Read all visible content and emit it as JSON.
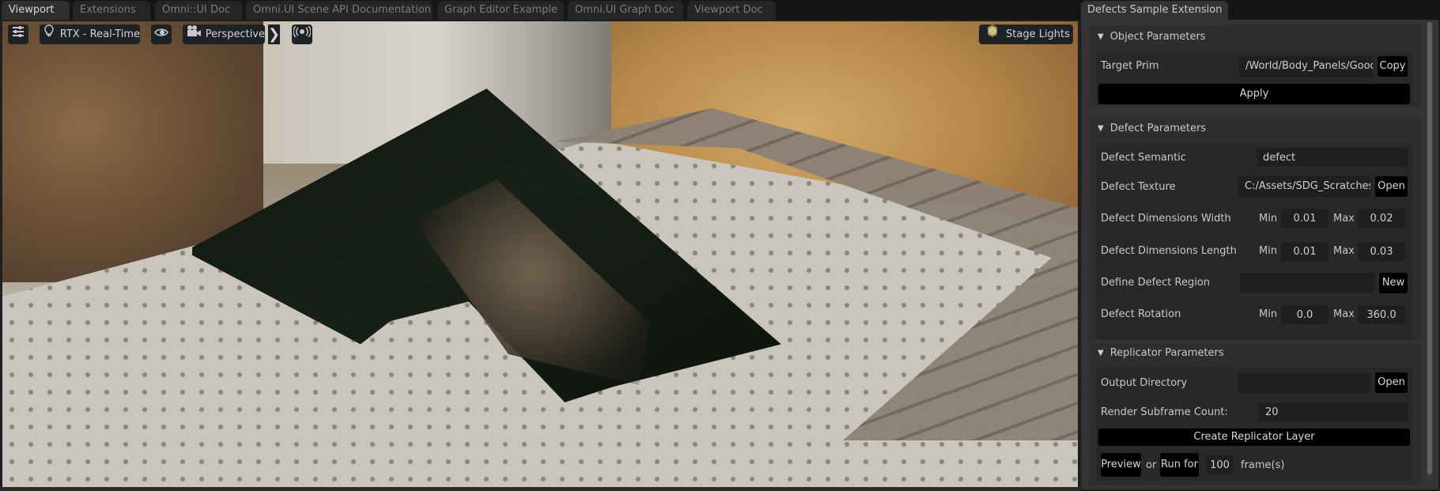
{
  "left_tabs": [
    {
      "label": "Viewport",
      "active": true
    },
    {
      "label": "Extensions",
      "active": false
    },
    {
      "label": "Omni::UI Doc",
      "active": false
    },
    {
      "label": "Omni.UI Scene API Documentation",
      "active": false
    },
    {
      "label": "Graph Editor Example",
      "active": false
    },
    {
      "label": "Omni.UI Graph Doc",
      "active": false
    },
    {
      "label": "Viewport Doc",
      "active": false
    }
  ],
  "viewport_toolbar": {
    "settings_icon": "sliders-icon",
    "renderer_icon": "lightbulb-icon",
    "renderer_label": "RTX - Real-Time",
    "visibility_icon": "eye-icon",
    "camera_icon": "movie-camera-icon",
    "camera_label": "Perspective",
    "expand_icon": "chevron-right-icon",
    "broadcast_icon": "broadcast-icon",
    "lights_icon": "sun-icon",
    "lights_label": "Stage Lights"
  },
  "extension": {
    "tab_title": "Defects Sample Extension",
    "object_parameters": {
      "title": "Object Parameters",
      "target_prim_label": "Target Prim",
      "target_prim_value": "/World/Body_Panels/Good/M",
      "copy_label": "Copy",
      "apply_label": "Apply"
    },
    "defect_parameters": {
      "title": "Defect Parameters",
      "semantic_label": "Defect Semantic",
      "semantic_value": "defect",
      "texture_label": "Defect Texture",
      "texture_value": "C:/Assets/SDG_Scratches/Sc",
      "texture_open_label": "Open",
      "width_label": "Defect Dimensions Width",
      "width_min": "0.01",
      "width_max": "0.02",
      "length_label": "Defect Dimensions Length",
      "length_min": "0.01",
      "length_max": "0.03",
      "region_label": "Define Defect Region",
      "region_value": "",
      "region_new_label": "New",
      "rotation_label": "Defect Rotation",
      "rotation_min": "0.0",
      "rotation_max": "360.0",
      "min_label": "Min",
      "max_label": "Max"
    },
    "replicator_parameters": {
      "title": "Replicator Parameters",
      "output_label": "Output Directory",
      "output_value": "",
      "output_open_label": "Open",
      "subframe_label": "Render Subframe Count:",
      "subframe_value": "20",
      "create_layer_label": "Create Replicator Layer",
      "preview_label": "Preview",
      "or_label": "or",
      "run_label": "Run for",
      "frames_value": "100",
      "frames_suffix": "frame(s)"
    }
  }
}
